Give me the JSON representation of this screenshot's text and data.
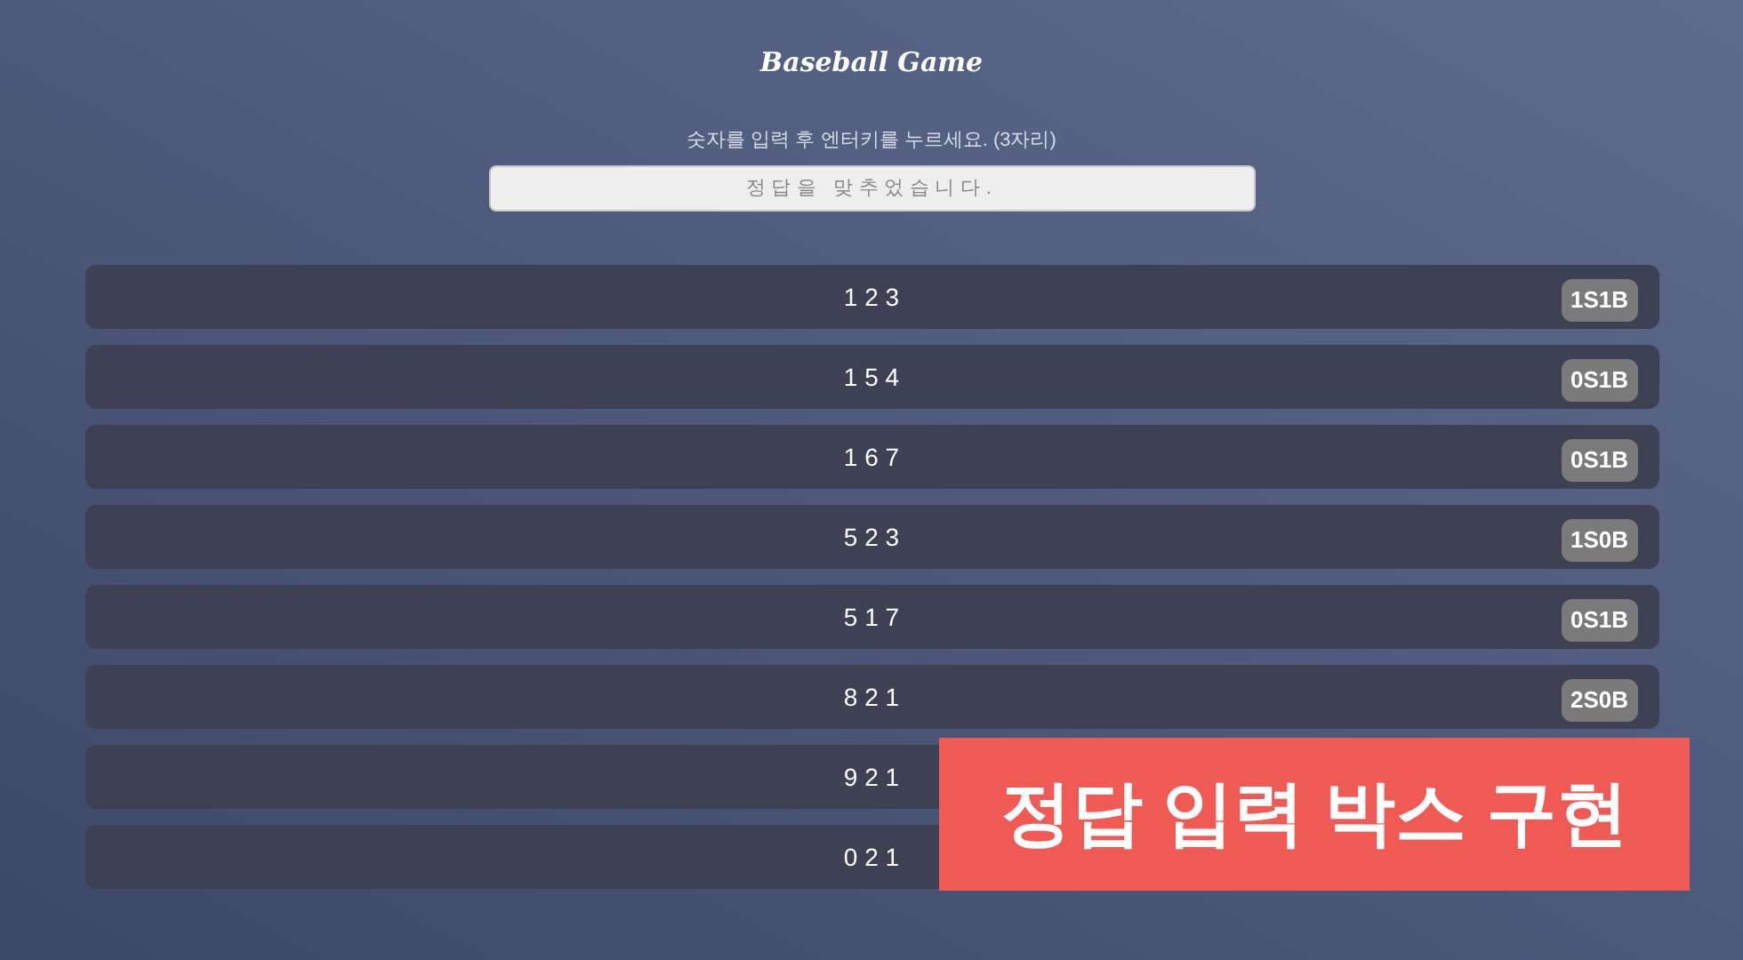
{
  "title": "Baseball Game",
  "instruction": "숫자를 입력 후 엔터키를 누르세요. (3자리)",
  "answer_field": {
    "placeholder": "정답을 맞추었습니다."
  },
  "guesses": [
    {
      "numbers": "1 2 3",
      "result": "1S1B"
    },
    {
      "numbers": "1 5 4",
      "result": "0S1B"
    },
    {
      "numbers": "1 6 7",
      "result": "0S1B"
    },
    {
      "numbers": "5 2 3",
      "result": "1S0B"
    },
    {
      "numbers": "5 1 7",
      "result": "0S1B"
    },
    {
      "numbers": "8 2 1",
      "result": "2S0B"
    },
    {
      "numbers": "9 2 1"
    },
    {
      "numbers": "0 2 1"
    }
  ],
  "banner": "정답 입력 박스 구현"
}
